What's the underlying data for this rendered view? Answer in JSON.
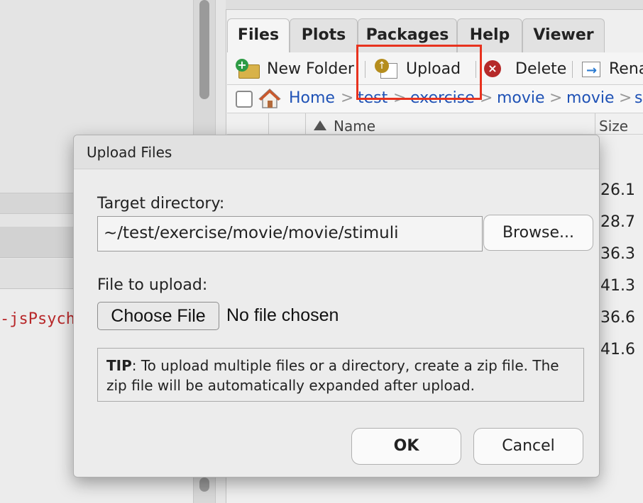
{
  "left_pane": {
    "code_snippet": "-jsPsych"
  },
  "tabs": [
    {
      "label": "Files",
      "active": true
    },
    {
      "label": "Plots",
      "active": false
    },
    {
      "label": "Packages",
      "active": false
    },
    {
      "label": "Help",
      "active": false
    },
    {
      "label": "Viewer",
      "active": false
    }
  ],
  "toolbar": {
    "new_folder_label": "New Folder",
    "upload_label": "Upload",
    "delete_label": "Delete",
    "rename_label": "Rena",
    "highlight_color": "#e8321e"
  },
  "breadcrumb": {
    "items": [
      "Home",
      "test",
      "exercise",
      "movie",
      "movie",
      "s"
    ],
    "separator": ">"
  },
  "file_list": {
    "name_header": "Name",
    "size_header": "Size",
    "sizes": [
      "26.1",
      "28.7",
      "36.3",
      "41.3",
      "36.6",
      "41.6"
    ]
  },
  "dialog": {
    "title": "Upload Files",
    "target_label": "Target directory:",
    "target_value": "~/test/exercise/movie/movie/stimuli",
    "browse_label": "Browse...",
    "file_label": "File to upload:",
    "choose_label": "Choose File",
    "no_file_text": "No file chosen",
    "tip_bold": "TIP",
    "tip_text": ": To upload multiple files or a directory, create a zip file. The zip file will be automatically expanded after upload.",
    "ok_label": "OK",
    "cancel_label": "Cancel"
  }
}
